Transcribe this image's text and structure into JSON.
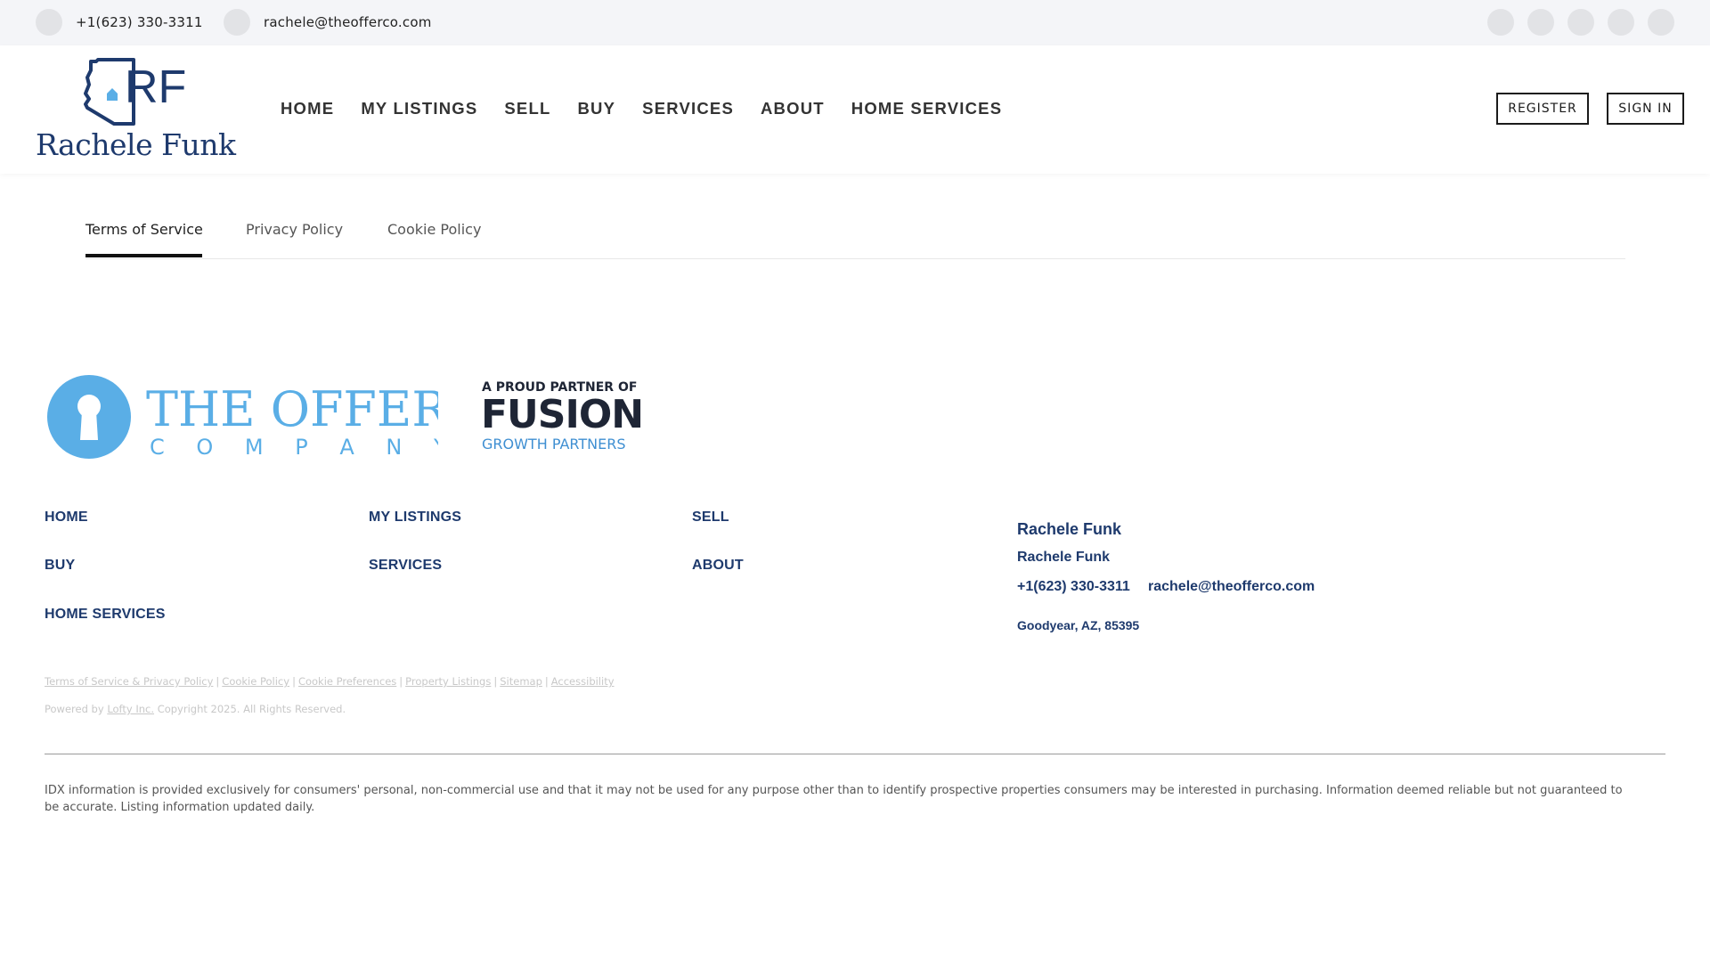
{
  "topbar": {
    "phone": "+1(623) 330-3311",
    "email": "rachele@theofferco.com",
    "social_icons": [
      "social-icon-1",
      "social-icon-2",
      "social-icon-3",
      "social-icon-4",
      "social-icon-5"
    ]
  },
  "header": {
    "logo_initials": "RF",
    "logo_name": "Rachele Funk",
    "nav": [
      "HOME",
      "MY LISTINGS",
      "SELL",
      "BUY",
      "SERVICES",
      "ABOUT",
      "HOME SERVICES"
    ],
    "register_label": "REGISTER",
    "signin_label": "SIGN IN"
  },
  "tabs": {
    "items": [
      "Terms of Service",
      "Privacy Policy",
      "Cookie Policy"
    ],
    "active": "Terms of Service"
  },
  "partners": {
    "offer_line1": "THE OFFER",
    "offer_line2": "C O M P A N Y",
    "fusion_line1": "A PROUD PARTNER OF",
    "fusion_line2": "FUSION",
    "fusion_line3": "GROWTH PARTNERS"
  },
  "footer_nav": {
    "home": "HOME",
    "my_listings": "MY LISTINGS",
    "sell": "SELL",
    "buy": "BUY",
    "services": "SERVICES",
    "about": "ABOUT",
    "home_services": "HOME SERVICES"
  },
  "contact": {
    "title": "Rachele Funk",
    "name": "Rachele Funk",
    "phone": "+1(623) 330-3311",
    "email": "rachele@theofferco.com",
    "address": "Goodyear, AZ, 85395"
  },
  "legal": {
    "links": [
      "Terms of Service & Privacy Policy",
      "Cookie Policy",
      "Cookie Preferences",
      "Property Listings",
      "Sitemap",
      "Accessibility"
    ],
    "separator": "|",
    "powered_prefix": "Powered by",
    "powered_link": "Lofty Inc.",
    "copyright": "Copyright 2025. All Rights Reserved."
  },
  "idx_text": "IDX information is provided exclusively for consumers' personal, non-commercial use and that it may not be used for any purpose other than to identify prospective properties consumers may be interested in purchasing. Information deemed reliable but not guaranteed to be accurate. Listing information updated daily.",
  "colors": {
    "brand_navy": "#1e3a6d",
    "brand_blue": "#5aaee6",
    "topbar_bg": "#f4f5f8"
  }
}
